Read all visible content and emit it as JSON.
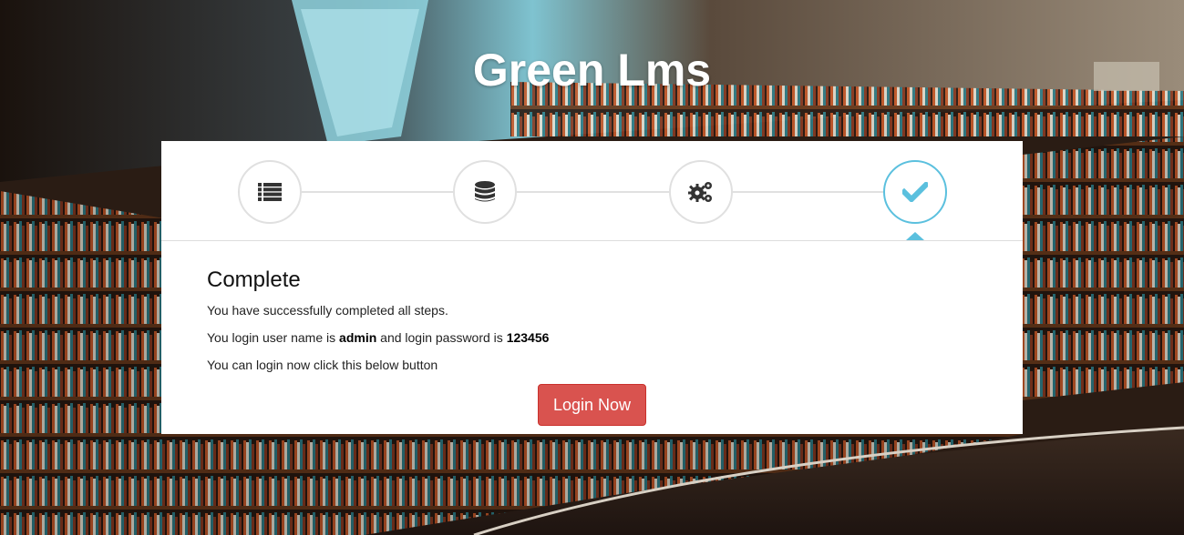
{
  "header": {
    "title": "Green Lms"
  },
  "wizard": {
    "steps": [
      {
        "icon": "list-icon",
        "state": "done"
      },
      {
        "icon": "database-icon",
        "state": "done"
      },
      {
        "icon": "gears-icon",
        "state": "done"
      },
      {
        "icon": "check-icon",
        "state": "active"
      }
    ],
    "accent_color": "#5bc0de"
  },
  "content": {
    "heading": "Complete",
    "line1": "You have successfully completed all steps.",
    "line2_prefix": "You login user name is ",
    "username": "admin",
    "line2_middle": " and login password is ",
    "password": "123456",
    "line3": "You can login now click this below button",
    "login_button": "Login Now",
    "button_color": "#d9534f"
  }
}
